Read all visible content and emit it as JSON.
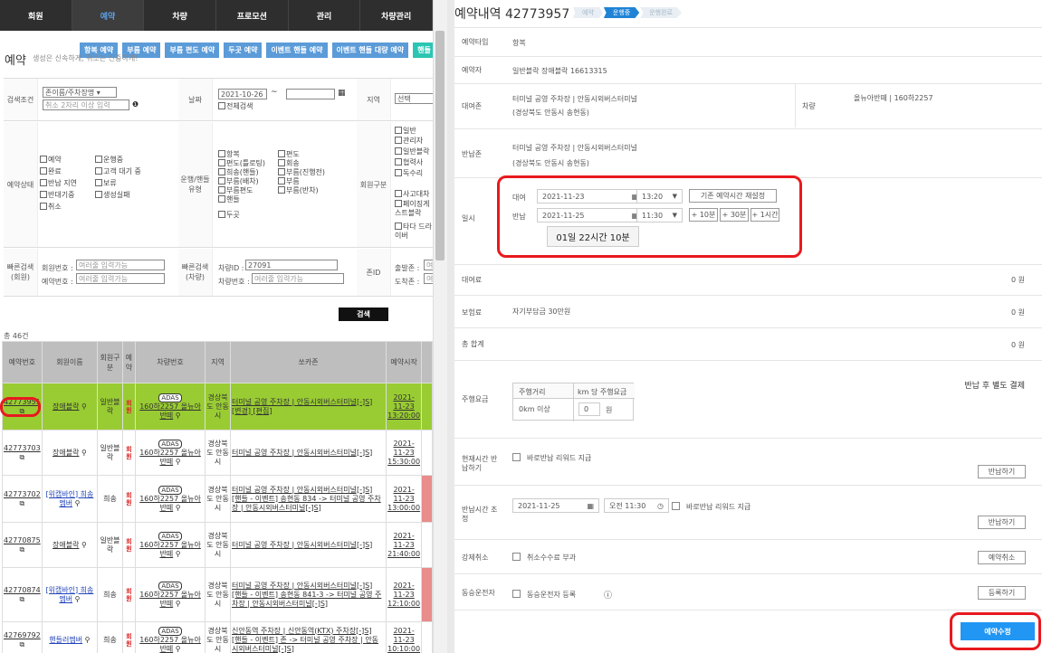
{
  "nav": [
    "회원",
    "예약",
    "차량",
    "프로모션",
    "관리",
    "차량관리"
  ],
  "actions": [
    "항복 예약",
    "부름 예약",
    "부름 편도 예약",
    "두곳 예약",
    "이벤트 핸들 예약",
    "이벤트 핸들 대량 예약",
    "핸들"
  ],
  "page": {
    "title": "예약",
    "subtitle": "생성은 신속하게, 취소는 신중하게!"
  },
  "search": {
    "cond_label": "검색조건",
    "cond_select": "존이름/주차장명",
    "cond_input": "취소 2자리 이상 입력",
    "date_label": "날짜",
    "date_from": "2021-10-26",
    "date_to": "",
    "all": "전체검색",
    "region_label": "지역",
    "region_select": "선택",
    "status_label": "예약상태",
    "status": [
      "예약",
      "완료",
      "반납 지연",
      "반대기중",
      "취소",
      "운행중",
      "고객 대기 중",
      "보류",
      "생성실패"
    ],
    "type_label": "운행/핸들 유형",
    "types": [
      "항복",
      "편도(틀로팅)",
      "희송(핸들)",
      "부름(배차)",
      "부름편도",
      "핸들",
      "편도",
      "회송",
      "부름(진행전)",
      "부름",
      "부름(반차)",
      "두곳"
    ],
    "member_label": "회원구분",
    "members": [
      "일반",
      "관리자",
      "일반블락",
      "협력사",
      "독수리",
      "사고대차",
      "페이징게스트블락",
      "타다 드라이버"
    ],
    "quick_member_label": "빠른검색 (회원)",
    "member_no_label": "회원번호 :",
    "member_no_ph": "여러줄 입력가능",
    "res_no_label": "예약번호 :",
    "res_no_ph": "여러줄 입력가능",
    "quick_car_label": "빠른검색 (차량)",
    "car_id_label": "차량ID :",
    "car_id": "27091",
    "car_no_label": "차량번호 :",
    "car_no_ph": "여러줄 입력가능",
    "zone_label": "존ID",
    "dep_label": "출발존 :",
    "arr_label": "도착존 :",
    "zone_ph": "여러",
    "search_button": "검색",
    "total": "총 46건"
  },
  "table": {
    "headers": [
      "예약번호",
      "회원이름",
      "회원구분",
      "예약",
      "차량번호",
      "지역",
      "쏘카존",
      "예약시작"
    ],
    "rows": [
      {
        "id": "42773951",
        "name": "장애블락",
        "mtype": "일반블락",
        "car": "160하2257 올뉴아반떼",
        "region": "경상북도 안동시",
        "zone": "터미널 공영 주차장 | 안동시외버스터미널[-]S]",
        "zone2": "[변경] [편집]",
        "start": "2021-11-23 13:20:00",
        "green": true
      },
      {
        "id": "42773703",
        "name": "장애블락",
        "mtype": "일반블락",
        "car": "160하2257 올뉴아반떼",
        "region": "경상북도 안동시",
        "zone": "터미널 공영 주차장 | 안동시외버스터미널[-]S]",
        "zone2": "",
        "start": "2021-11-23 15:30:00",
        "green": false
      },
      {
        "id": "42773702",
        "name": "[위캡바인] 희송멤버",
        "mtype": "희송",
        "car": "160하2257 올뉴아반떼",
        "region": "경상북도 안동시",
        "zone": "터미널 공영 주차장 | 안동시외버스터미널[-]S]",
        "zone2": "[핸들 - 이벤트] 송현동 834 -> 터미널 공영 주차장 | 안동시외버스터미널[-]S]",
        "start": "2021-11-23 13:00:00",
        "green": false
      },
      {
        "id": "42770875",
        "name": "장애블락",
        "mtype": "일반블락",
        "car": "160하2257 올뉴아반떼",
        "region": "경상북도 안동시",
        "zone": "터미널 공영 주차장 | 안동시외버스터미널[-]S]",
        "zone2": "",
        "start": "2021-11-23 21:40:00",
        "green": false
      },
      {
        "id": "42770874",
        "name": "[위캡바인] 희송멤버",
        "mtype": "희송",
        "car": "160하2257 올뉴아반떼",
        "region": "경상북도 안동시",
        "zone": "터미널 공영 주차장 | 안동시외버스터미널[-]S]",
        "zone2": "[핸들 - 이벤트] 송현동 841-3 -> 터미널 공영 주차장 | 안동시외버스터미널[-]S]",
        "start": "2021-11-23 12:10:00",
        "green": false
      },
      {
        "id": "42769792",
        "name": "핸들러멤버",
        "mtype": "희송",
        "car": "160하2257 올뉴아반떼",
        "region": "경상북도 안동시",
        "zone": "신안동역 주차장 | 신안동역(KTX) 주차장[-]S]",
        "zone2": "[핸들 - 이벤트] 존 -> 터미널 공영 주차장 | 안동시외버스터미널[-]S]",
        "start": "2021-11-23 10:10:00",
        "green": false
      }
    ],
    "res_badge": "회원",
    "adas": "ADAS",
    "tag": "도로명 주소"
  },
  "detail": {
    "title": "예약내역 42773957",
    "steps": [
      "예약",
      "운행중",
      "운행완료"
    ],
    "type_label": "예약타입",
    "type": "항복",
    "booker_label": "예약자",
    "booker": "일반블락 장애블락 16613315",
    "pickup_label": "대여존",
    "pickup_zone": "터미널 공영 주차장 | 안동시외버스터미널",
    "pickup_addr": "(경상북도 안동시 송현동)",
    "car_label": "차량",
    "car": "올뉴아반떼 | 160하2257",
    "return_label": "반납존",
    "return_zone": "터미널 공영 주차장 | 안동시외버스터미널",
    "return_addr": "(경상북도 안동시 송현동)",
    "time_label": "일시",
    "rent_label": "대여",
    "rent_date": "2021-11-23",
    "rent_time": "13:20",
    "reset_btn": "기존 예약시간 재설정",
    "ret_label": "반납",
    "ret_date": "2021-11-25",
    "ret_time": "11:30",
    "plus10": "+ 10분",
    "plus30": "+ 30분",
    "plus1h": "+ 1시간",
    "duration": "01일 22시간 10분",
    "fee_label": "대여료",
    "fee": "0 원",
    "ins_label": "보험료",
    "ins_note": "자기부담금 30만원",
    "ins": "0 원",
    "total_label": "총 합계",
    "total": "0 원",
    "drive_label": "주행요금",
    "drive_note": "반납 후 별도 결제",
    "drive_col1": "주행거리",
    "drive_col2": "km 당 주행요금",
    "drive_row": "0km 이상",
    "drive_val": "0",
    "drive_unit": "원",
    "now_label": "현재시간 반납하기",
    "now_chk": "바로반납 리워드 지급",
    "now_btn": "반납하기",
    "adj_label": "반납시간 조정",
    "adj_date": "2021-11-25",
    "adj_time": "오전 11:30",
    "adj_chk": "바로반납 리워드 지급",
    "adj_btn": "반납하기",
    "cancel_label": "강제취소",
    "cancel_chk": "취소수수료 부과",
    "cancel_btn": "예약취소",
    "driver_label": "동승운전자",
    "driver_chk": "동승운전자 등록",
    "driver_btn": "등록하기",
    "modify_btn": "예약수정"
  }
}
